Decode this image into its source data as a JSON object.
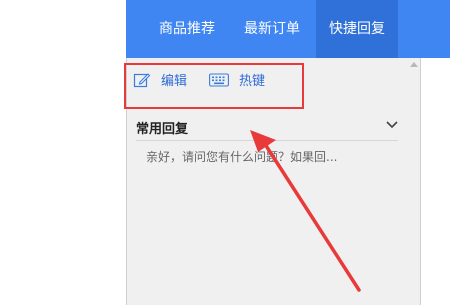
{
  "tabs": [
    {
      "label": "商品推荐"
    },
    {
      "label": "最新订单"
    },
    {
      "label": "快捷回复"
    }
  ],
  "toolbar": {
    "edit_label": "编辑",
    "hotkey_label": "热键"
  },
  "section": {
    "title": "常用回复"
  },
  "replies": [
    {
      "text": "亲好，请问您有什么问题？如果回..."
    }
  ],
  "colors": {
    "header": "#3f86f2",
    "active_tab": "#2f70d9",
    "highlight": "#e83a3a",
    "link": "#2e6bd6"
  }
}
